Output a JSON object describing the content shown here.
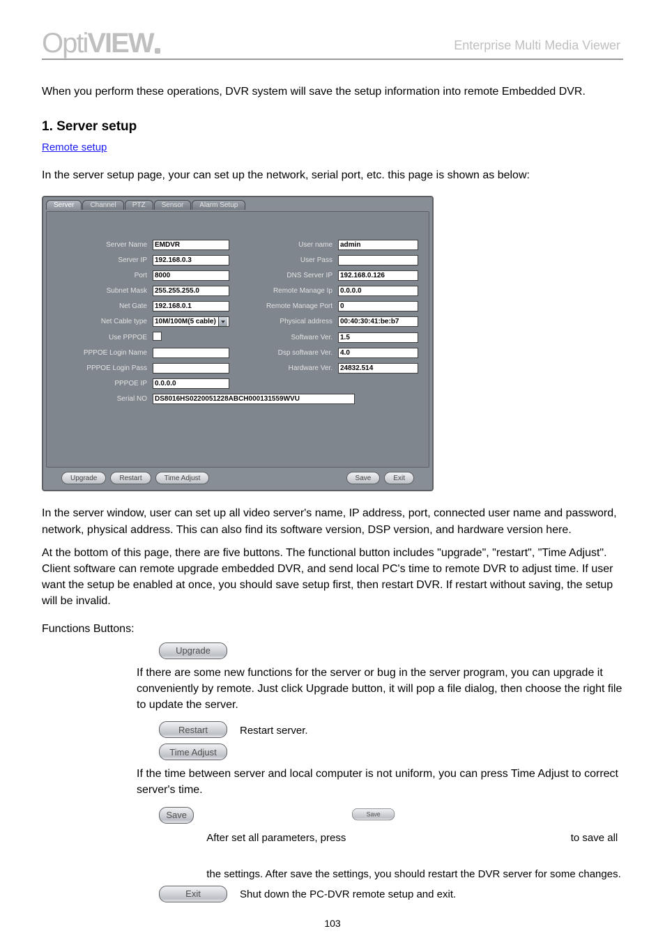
{
  "header": {
    "logo_a": "Opti",
    "logo_b": "VIEW",
    "doc_title": "Enterprise Multi Media Viewer"
  },
  "intro_1": "When you perform these operations, DVR system will save the setup information into remote Embedded DVR.",
  "h1": "1. Server setup",
  "sub": "Remote setup",
  "intro_2": "In the server setup page, your can set up the network, serial port, etc. this page is shown as below:",
  "intro_3": "In the server window, user can set up all video server's name, IP address, port, connected user name and password, network, physical address. This can also find its software version, DSP version, and hardware version here.",
  "tabs": {
    "server": "Server",
    "channel": "Channel",
    "ptz": "PTZ",
    "sensor": "Sensor",
    "alarm": "Alarm Setup"
  },
  "form": {
    "server_name_l": "Server Name",
    "server_name_v": "EMDVR",
    "user_name_l": "User name",
    "user_name_v": "admin",
    "server_ip_l": "Server IP",
    "server_ip_v": "192.168.0.3",
    "user_pass_l": "User Pass",
    "user_pass_v": "",
    "port_l": "Port",
    "port_v": "8000",
    "dns_l": "DNS Server IP",
    "dns_v": "192.168.0.126",
    "mask_l": "Subnet Mask",
    "mask_v": "255.255.255.0",
    "rmi_l": "Remote Manage Ip",
    "rmi_v": "0.0.0.0",
    "gate_l": "Net Gate",
    "gate_v": "192.168.0.1",
    "rmp_l": "Remote Manage Port",
    "rmp_v": "0",
    "cable_l": "Net Cable type",
    "cable_v": "10M/100M(5 cable)",
    "phys_l": "Physical address",
    "phys_v": "00:40:30:41:be:b7",
    "pppoe_use_l": "Use PPPOE",
    "soft_l": "Software Ver.",
    "soft_v": "1.5",
    "pppoe_login_l": "PPPOE Login Name",
    "pppoe_login_v": "",
    "dsp_l": "Dsp software Ver.",
    "dsp_v": "4.0",
    "pppoe_pass_l": "PPPOE Login Pass",
    "pppoe_pass_v": "",
    "hw_l": "Hardware Ver.",
    "hw_v": "24832.514",
    "pppoe_ip_l": "PPPOE IP",
    "pppoe_ip_v": "0.0.0.0",
    "serial_l": "Serial NO",
    "serial_v": "DS8016HS0220051228ABCH000131559WVU"
  },
  "btns": {
    "upgrade": "Upgrade",
    "restart": "Restart",
    "time": "Time Adjust",
    "save": "Save",
    "exit": "Exit"
  },
  "after": "At the bottom of this page, there are five buttons. The functional button includes \"upgrade\", \"restart\", \"Time Adjust\". Client software can remote upgrade embedded DVR, and send local PC's time to remote DVR to adjust time. If user want the setup be enabled at once, you should save setup first, then restart DVR. If restart without saving, the setup will be invalid.",
  "funcs": "Functions Buttons:",
  "upg_txt": "If there are some new functions for the server or bug in the server program, you can upgrade it conveniently by remote. Just click Upgrade button, it will pop a file dialog, then choose the right file to update the server.",
  "restart_txt": "Restart server.",
  "time_txt": "If the time between server and local computer is not uniform, you can press Time Adjust to correct server's time.",
  "save_txt": "After set all parameters, press",
  "save_txt2": "to save all the settings. After save the settings, you should restart the DVR server for some changes.",
  "exit_txt": "Shut down the PC-DVR remote setup and exit.",
  "page_num": "103"
}
